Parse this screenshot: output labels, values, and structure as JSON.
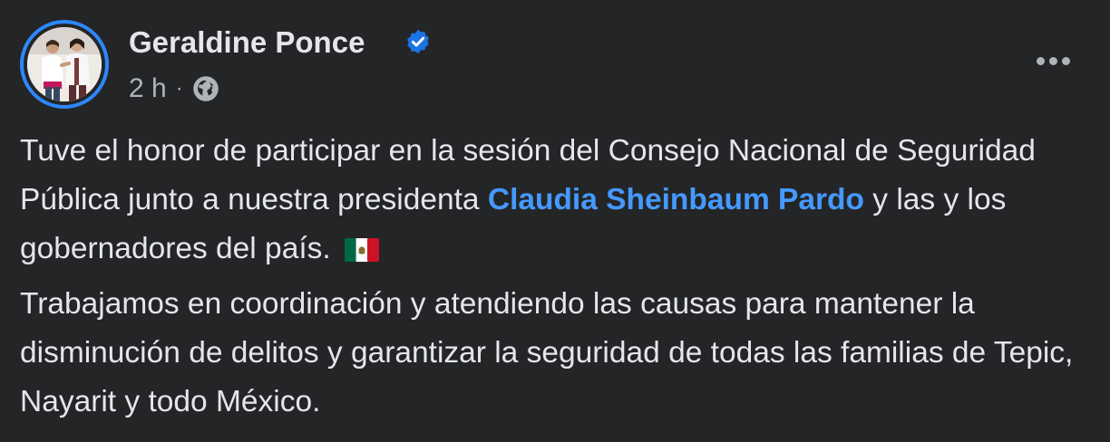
{
  "post": {
    "author": "Geraldine Ponce",
    "verified_icon": "verified-badge-icon",
    "timestamp": "2 h",
    "separator": "·",
    "audience_icon": "globe-icon",
    "more_icon": "more-options-icon",
    "avatar_icon": "profile-photo",
    "paragraph1": {
      "text_before": "Tuve el honor de participar en la sesión del Consejo Nacional de Seguridad Pública junto a nuestra presidenta ",
      "mention": "Claudia Sheinbaum Pardo",
      "text_after": " y las y los gobernadores del país. ",
      "flag_icon": "mexico-flag-emoji"
    },
    "paragraph2": "Trabajamos en coordinación y atendiendo las causas para mantener la disminución de delitos y garantizar la seguridad de todas las familias de Tepic, Nayarit y todo México."
  },
  "colors": {
    "background": "#242526",
    "text_primary": "#e4e6eb",
    "text_secondary": "#b0b3b8",
    "link": "#4599ff",
    "story_ring": "#2d88ff",
    "verified": "#1b74e4"
  }
}
